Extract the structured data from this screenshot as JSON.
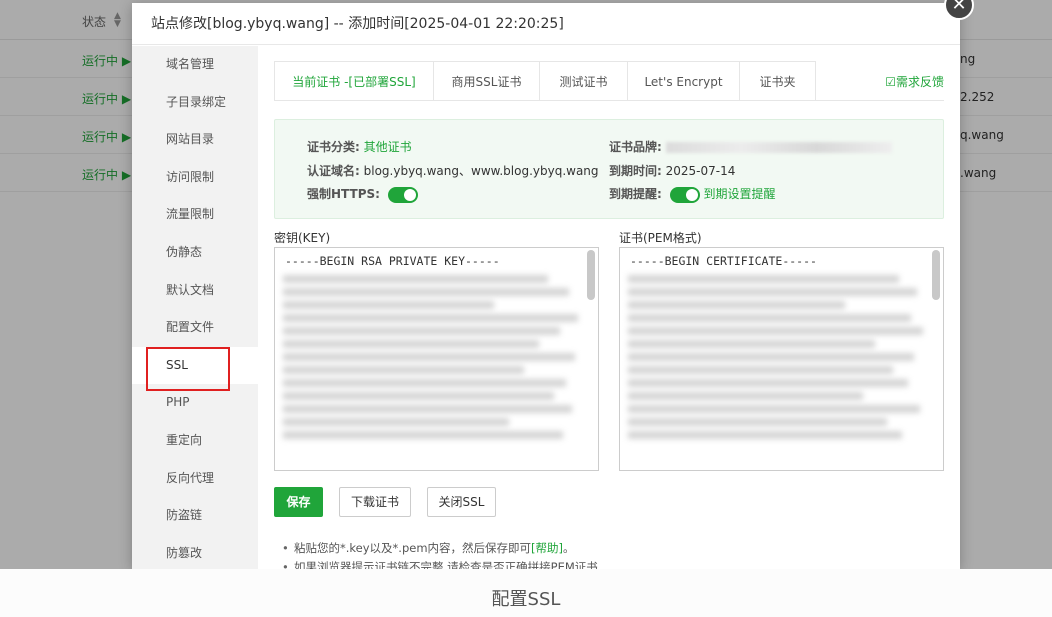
{
  "background": {
    "status_header": "状态",
    "sort_icon": "sort-arrows-icon",
    "rows": [
      {
        "status": "运行中 ▶",
        "tail": "ng"
      },
      {
        "status": "运行中 ▶",
        "tail": "2.252"
      },
      {
        "status": "运行中 ▶",
        "tail": "q.wang"
      },
      {
        "status": "运行中 ▶",
        "tail": ".wang"
      }
    ]
  },
  "modal": {
    "title": "站点修改[blog.ybyq.wang] -- 添加时间[2025-04-01 22:20:25]",
    "close_icon": "close-icon"
  },
  "sidebar": {
    "items": [
      {
        "label": "域名管理"
      },
      {
        "label": "子目录绑定"
      },
      {
        "label": "网站目录"
      },
      {
        "label": "访问限制"
      },
      {
        "label": "流量限制"
      },
      {
        "label": "伪静态"
      },
      {
        "label": "默认文档"
      },
      {
        "label": "配置文件"
      },
      {
        "label": "SSL"
      },
      {
        "label": "PHP"
      },
      {
        "label": "重定向"
      },
      {
        "label": "反向代理"
      },
      {
        "label": "防盗链"
      },
      {
        "label": "防篡改"
      }
    ],
    "active_index": 8
  },
  "tabs": [
    {
      "label": "当前证书 -[已部署SSL]"
    },
    {
      "label": "商用SSL证书"
    },
    {
      "label": "测试证书"
    },
    {
      "label": "Let's Encrypt"
    },
    {
      "label": "证书夹"
    }
  ],
  "feedback": "需求反馈",
  "cert_info": {
    "category_label": "证书分类:",
    "category_value": "其他证书",
    "domain_label": "认证域名:",
    "domain_value": "blog.ybyq.wang、www.blog.ybyq.wang",
    "https_label": "强制HTTPS:",
    "brand_label": "证书品牌:",
    "expire_label": "到期时间:",
    "expire_value": "2025-07-14",
    "reminder_label": "到期提醒:",
    "reminder_link": "到期设置提醒"
  },
  "key_field": {
    "label": "密钥(KEY)",
    "first_line": "-----BEGIN RSA PRIVATE KEY-----"
  },
  "cert_field": {
    "label": "证书(PEM格式)",
    "first_line": "-----BEGIN CERTIFICATE-----"
  },
  "buttons": {
    "save": "保存",
    "download": "下载证书",
    "close_ssl": "关闭SSL"
  },
  "notes": {
    "note1_prefix": "粘贴您的*.key以及*.pem内容，然后保存即可",
    "note1_link": "[帮助]",
    "note1_suffix": "。",
    "note2": "如果浏览器提示证书链不完整,请检查是否正确拼接PEM证书"
  },
  "caption": "配置SSL",
  "colors": {
    "accent": "#20a53a",
    "highlight": "#e02020"
  }
}
